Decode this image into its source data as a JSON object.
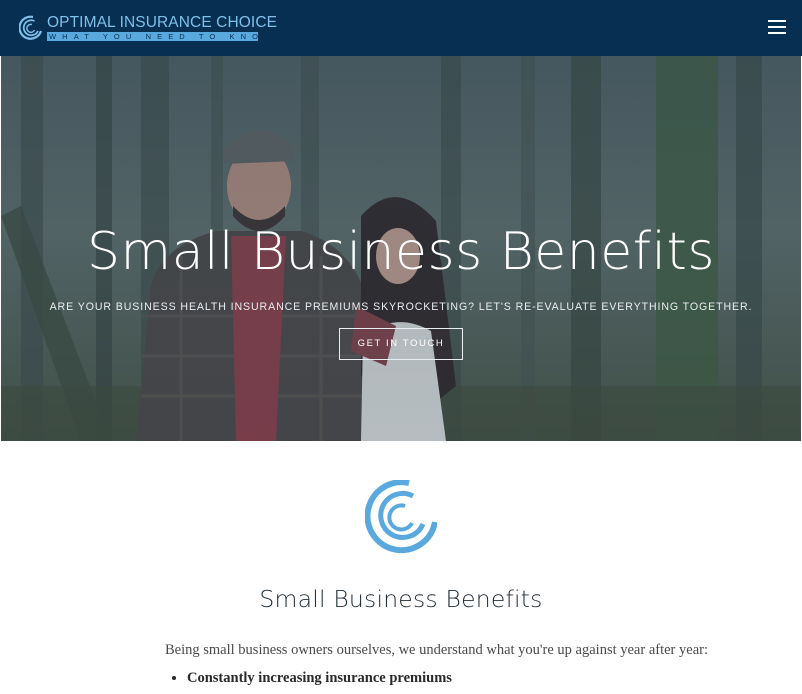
{
  "header": {
    "brand_title": "OPTIMAL INSURANCE CHOICE",
    "brand_tagline": "WHAT YOU NEED TO KNOW",
    "menu_icon": "hamburger-menu-icon",
    "background_color": "#062f52",
    "brand_color": "#7fc0ea"
  },
  "hero": {
    "title": "Small Business Benefits",
    "subtitle": "ARE YOUR BUSINESS HEALTH INSURANCE PREMIUMS SKYROCKETING? LET'S RE-EVALUATE EVERYTHING TOGETHER.",
    "cta_label": "GET IN TOUCH",
    "image": "couple-in-forest-photo"
  },
  "content": {
    "emblem_icon": "swirl-logo-icon",
    "title": "Small Business Benefits",
    "intro": "Being small business owners ourselves, we understand what you're up against year after year:",
    "bullets": [
      "Constantly increasing insurance premiums"
    ],
    "accent_color": "#5aa9de"
  }
}
